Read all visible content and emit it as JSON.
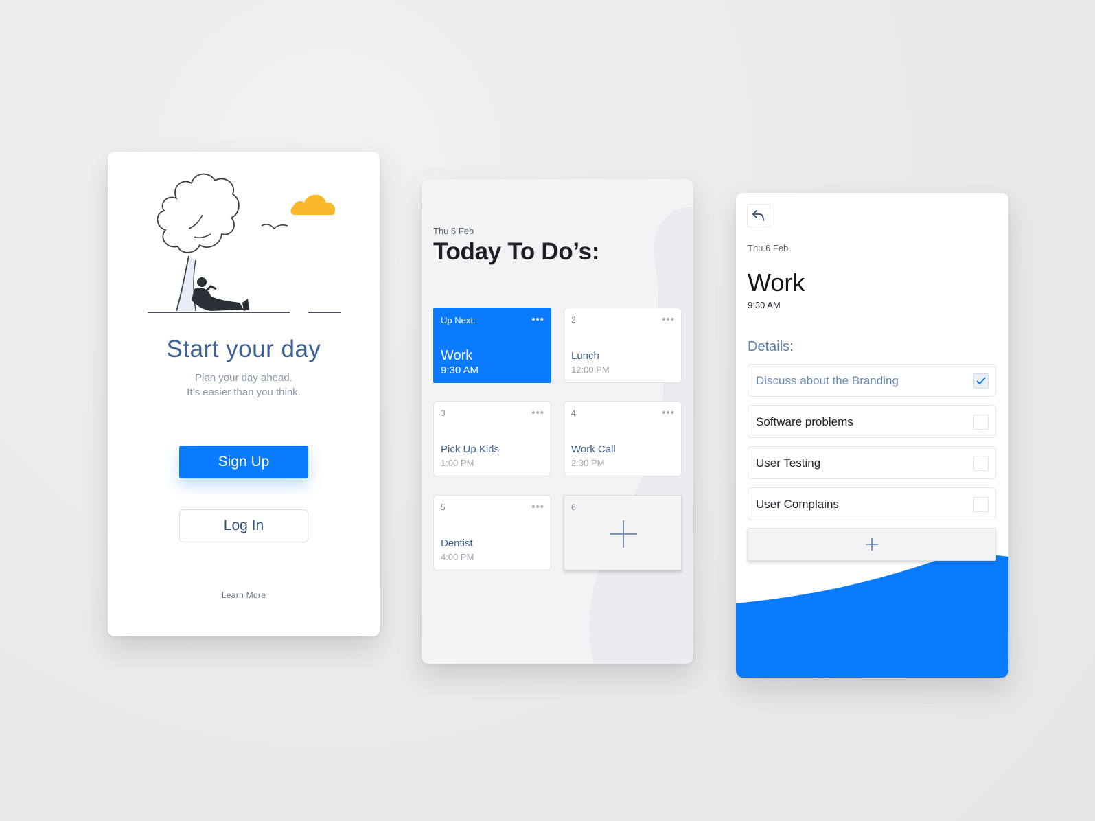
{
  "colors": {
    "accent": "#0a7bff",
    "title_blue": "#3e6294",
    "cloud": "#f9b92b",
    "background": "#ececec"
  },
  "welcome": {
    "title": "Start your day",
    "subtitle_line1": "Plan your day ahead.",
    "subtitle_line2": "It’s easier than you think.",
    "signup_label": "Sign Up",
    "login_label": "Log In",
    "learn_more_label": "Learn More",
    "illustration_icons": [
      "tree-icon",
      "person-reclining-icon",
      "bird-icon",
      "cloud-icon"
    ]
  },
  "today": {
    "date": "Thu 6 Feb",
    "title": "Today To Do’s:",
    "tiles": [
      {
        "number": "Up Next:",
        "name": "Work",
        "time": "9:30 AM",
        "active": true
      },
      {
        "number": "2",
        "name": "Lunch",
        "time": "12:00 PM",
        "active": false
      },
      {
        "number": "3",
        "name": "Pick Up Kids",
        "time": "1:00 PM",
        "active": false
      },
      {
        "number": "4",
        "name": "Work Call",
        "time": "2:30 PM",
        "active": false
      },
      {
        "number": "5",
        "name": "Dentist",
        "time": "4:00 PM",
        "active": false
      }
    ],
    "add_tile_number": "6",
    "more_glyph": "•••"
  },
  "detail": {
    "date": "Thu 6 Feb",
    "title": "Work",
    "time": "9:30 AM",
    "details_label": "Details:",
    "tasks": [
      {
        "label": "Discuss about the Branding",
        "checked": true
      },
      {
        "label": "Software problems",
        "checked": false
      },
      {
        "label": "User Testing",
        "checked": false
      },
      {
        "label": "User Complains",
        "checked": false
      }
    ]
  }
}
